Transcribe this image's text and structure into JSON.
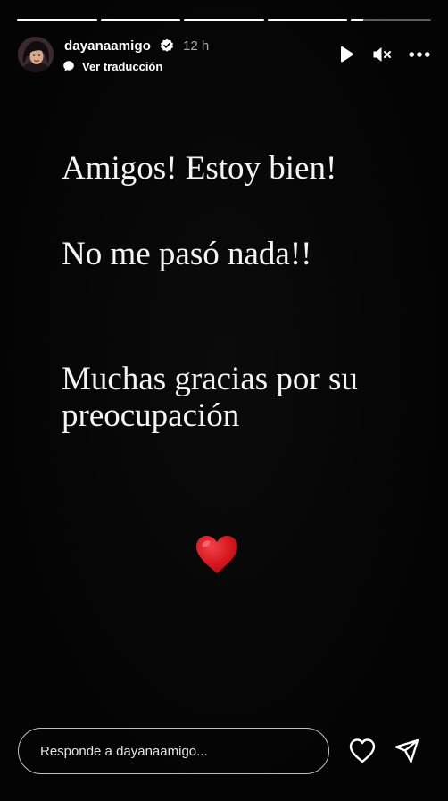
{
  "story": {
    "progress": [
      1,
      1,
      1,
      1,
      0.15
    ]
  },
  "header": {
    "username": "dayanaamigo",
    "verified_icon": "verified-badge-icon",
    "time_ago": "12 h",
    "translate_label": "Ver traducción",
    "translate_icon": "translate-bubble-icon",
    "controls": [
      "play-icon",
      "muted-speaker-icon",
      "more-options-icon"
    ]
  },
  "content": {
    "line1": "Amigos! Estoy bien!",
    "line2": "No me pasó nada!!",
    "line3": "Muchas gracias por su preocupación",
    "emoji": "red-heart-emoji"
  },
  "reply": {
    "placeholder": "Responde a dayanaamigo..."
  },
  "actions": {
    "like_icon": "heart-outline-icon",
    "share_icon": "paper-plane-icon"
  },
  "colors": {
    "background": "#050505",
    "text": "#ffffff",
    "verified": "#ffffff",
    "heart": "#d71920"
  }
}
